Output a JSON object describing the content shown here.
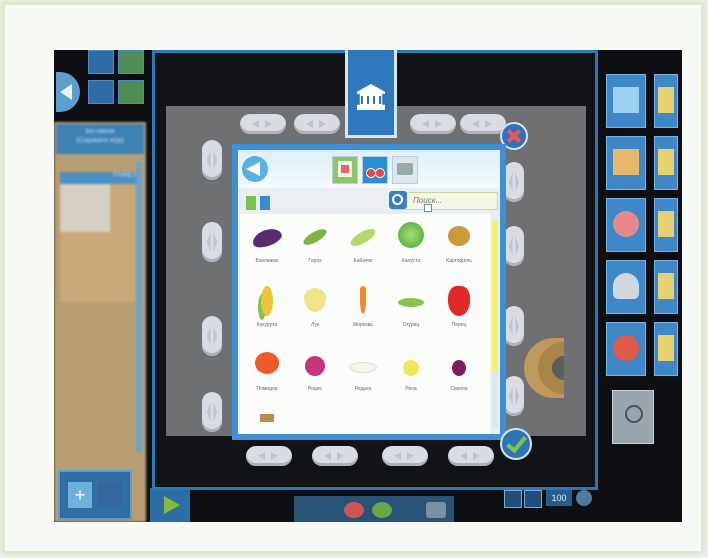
{
  "left_panel": {
    "header_line1": "Без имени",
    "header_line2": "(Сохраните игру)",
    "slot_label": "Слайд 1"
  },
  "library": {
    "search_placeholder": "Поиск...",
    "items": [
      {
        "label": "Баклажан",
        "icon": "eggplant"
      },
      {
        "label": "Горох",
        "icon": "peas"
      },
      {
        "label": "Кабачок",
        "icon": "zucchini"
      },
      {
        "label": "Капуста",
        "icon": "cabbage"
      },
      {
        "label": "Картофель",
        "icon": "potato"
      },
      {
        "label": "Кукуруза",
        "icon": "corn"
      },
      {
        "label": "Лук",
        "icon": "onion"
      },
      {
        "label": "Морковь",
        "icon": "carrot"
      },
      {
        "label": "Огурец",
        "icon": "cucumber"
      },
      {
        "label": "Перец",
        "icon": "pepper"
      },
      {
        "label": "Помидор",
        "icon": "tomato"
      },
      {
        "label": "Редис",
        "icon": "radish"
      },
      {
        "label": "Редька",
        "icon": "daikon"
      },
      {
        "label": "Репа",
        "icon": "turnip"
      },
      {
        "label": "Свекла",
        "icon": "beet"
      }
    ]
  },
  "zoom": {
    "level": "100"
  },
  "colors": {
    "accent": "#3e8fd6",
    "stage_border": "#2f77b7",
    "confirm": "#7fc742",
    "close": "#e8575a"
  }
}
